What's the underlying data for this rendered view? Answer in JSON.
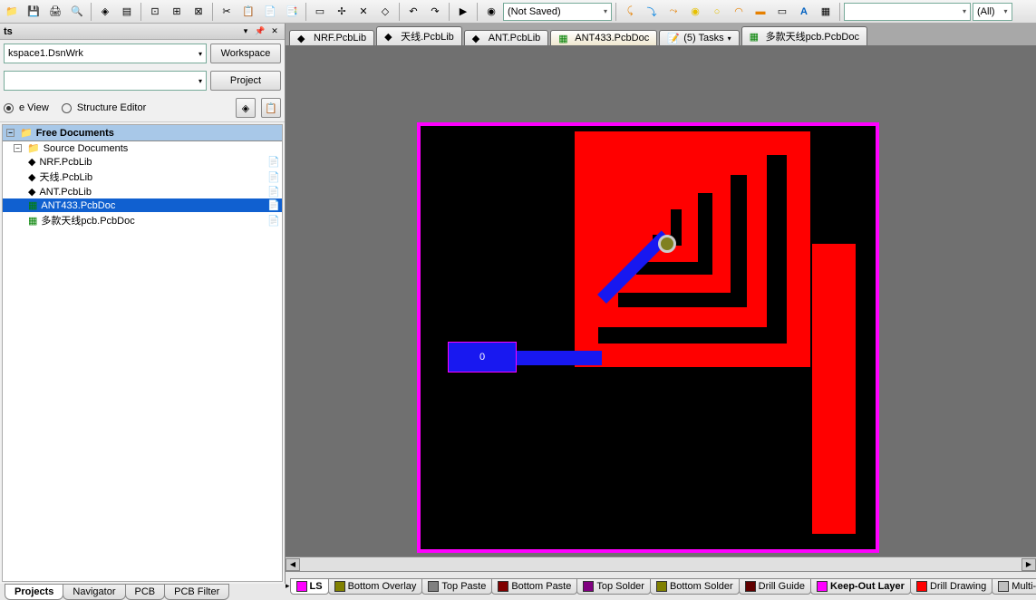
{
  "toolbar": {
    "combo1": "(Not Saved)",
    "filter": "(All)"
  },
  "panel": {
    "title": "ts",
    "workspace_file": "kspace1.DsnWrk",
    "workspace_btn": "Workspace",
    "project_input": "",
    "project_btn": "Project",
    "file_view": "e View",
    "structure": "Structure Editor"
  },
  "tree": {
    "root": "Free Documents",
    "src": "Source Documents",
    "items": [
      {
        "label": "NRF.PcbLib",
        "sel": false,
        "type": "lib"
      },
      {
        "label": "天线.PcbLib",
        "sel": false,
        "type": "lib"
      },
      {
        "label": "ANT.PcbLib",
        "sel": false,
        "type": "lib"
      },
      {
        "label": "ANT433.PcbDoc",
        "sel": true,
        "type": "pcb"
      },
      {
        "label": "多款天线pcb.PcbDoc",
        "sel": false,
        "type": "pcb"
      }
    ]
  },
  "bottom_tabs_left": [
    "Projects",
    "Navigator",
    "PCB",
    "PCB Filter"
  ],
  "doc_tabs": [
    {
      "label": "NRF.PcbLib",
      "active": false,
      "type": "lib"
    },
    {
      "label": "天线.PcbLib",
      "active": false,
      "type": "lib"
    },
    {
      "label": "ANT.PcbLib",
      "active": false,
      "type": "lib"
    },
    {
      "label": "ANT433.PcbDoc",
      "active": true,
      "type": "pcb"
    },
    {
      "label": "(5) Tasks",
      "active": false,
      "type": "task",
      "arrow": true
    },
    {
      "label": "多款天线pcb.PcbDoc",
      "active": false,
      "type": "pcb"
    }
  ],
  "pcb": {
    "pad_text": "0"
  },
  "layers": [
    {
      "name": "LS",
      "color": "#ff00ff",
      "active": true
    },
    {
      "name": "Bottom Overlay",
      "color": "#808000"
    },
    {
      "name": "Top Paste",
      "color": "#808080"
    },
    {
      "name": "Bottom Paste",
      "color": "#800000"
    },
    {
      "name": "Top Solder",
      "color": "#800080"
    },
    {
      "name": "Bottom Solder",
      "color": "#808000"
    },
    {
      "name": "Drill Guide",
      "color": "#600000"
    },
    {
      "name": "Keep-Out Layer",
      "color": "#ff00ff",
      "bold": true
    },
    {
      "name": "Drill Drawing",
      "color": "#ff0000"
    },
    {
      "name": "Multi-Lay",
      "color": "#c0c0c0"
    }
  ]
}
